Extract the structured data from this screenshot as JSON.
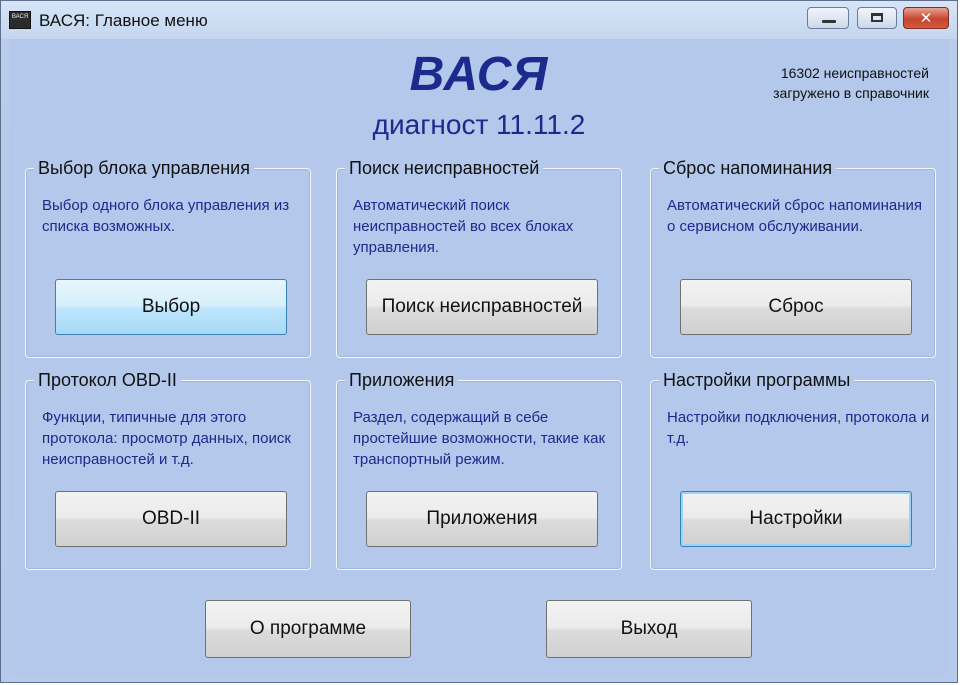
{
  "window": {
    "title": "ВАСЯ:  Главное меню",
    "icon_text": "ВАСЯ"
  },
  "header": {
    "app_name": "ВАСЯ",
    "version": "диагност 11.11.2",
    "db_info_line1": "16302 неисправностей",
    "db_info_line2": "загружено в справочник"
  },
  "groups": [
    {
      "legend": "Выбор блока управления",
      "description": "Выбор одного блока управления из списка возможных.",
      "button": "Выбор"
    },
    {
      "legend": "Поиск неисправностей",
      "description": "Автоматический поиск неисправностей во всех блоках управления.",
      "button": "Поиск неисправностей"
    },
    {
      "legend": "Сброс напоминания",
      "description": "Автоматический сброс напоминания о сервисном обслуживании.",
      "button": "Сброс"
    },
    {
      "legend": "Протокол OBD-II",
      "description": "Функции, типичные для этого протокола: просмотр данных, поиск неисправностей и т.д.",
      "button": "OBD-II"
    },
    {
      "legend": "Приложения",
      "description": "Раздел, содержащий в себе простейшие возможности, такие как транспортный режим.",
      "button": "Приложения"
    },
    {
      "legend": "Настройки программы",
      "description": "Настройки подключения, протокола и т.д.",
      "button": "Настройки"
    }
  ],
  "footer": {
    "about_label": "О программе",
    "exit_label": "Выход"
  }
}
